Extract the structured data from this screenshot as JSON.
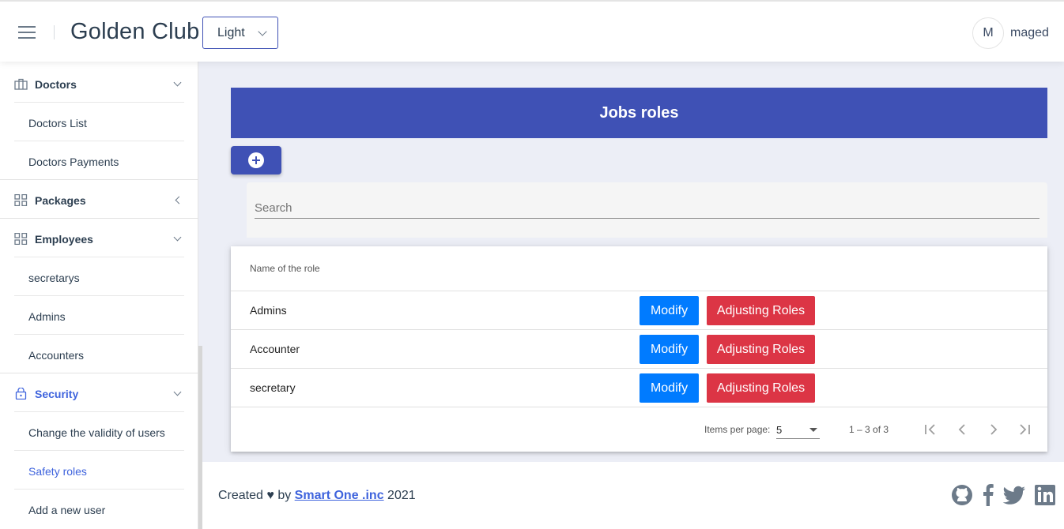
{
  "header": {
    "title": "Golden Club",
    "theme_value": "Light",
    "avatar_initial": "M",
    "username": "maged"
  },
  "sidebar": {
    "items": [
      {
        "label": "Doctors",
        "type": "group",
        "icon": "briefcase-icon",
        "chevron": "down"
      },
      {
        "label": "Doctors List",
        "type": "sub"
      },
      {
        "label": "Doctors Payments",
        "type": "sub"
      },
      {
        "label": "Packages",
        "type": "group",
        "icon": "grid-icon",
        "chevron": "left"
      },
      {
        "label": "Employees",
        "type": "group",
        "icon": "grid-icon",
        "chevron": "down"
      },
      {
        "label": "secretarys",
        "type": "sub"
      },
      {
        "label": "Admins",
        "type": "sub"
      },
      {
        "label": "Accounters",
        "type": "sub"
      },
      {
        "label": "Security",
        "type": "group",
        "icon": "lock-icon",
        "chevron": "down",
        "active": true
      },
      {
        "label": "Change the validity of users",
        "type": "sub"
      },
      {
        "label": "Safety roles",
        "type": "sub",
        "active": true
      },
      {
        "label": "Add a new user",
        "type": "sub"
      }
    ]
  },
  "main": {
    "banner_title": "Jobs roles",
    "add_icon": "plus-circle-icon",
    "search_placeholder": "Search",
    "table": {
      "columns": [
        "Name of the role"
      ],
      "rows": [
        {
          "name": "Admins",
          "modify_label": "Modify",
          "adjust_label": "Adjusting Roles"
        },
        {
          "name": "Accounter",
          "modify_label": "Modify",
          "adjust_label": "Adjusting Roles"
        },
        {
          "name": "secretary",
          "modify_label": "Modify",
          "adjust_label": "Adjusting Roles"
        }
      ]
    },
    "paginator": {
      "items_per_page_label": "Items per page:",
      "page_size": "5",
      "range_label": "1 – 3 of 3"
    }
  },
  "footer": {
    "created": "Created ♥ by",
    "company": "Smart One .inc",
    "year": "2021",
    "social_icons": [
      "github-icon",
      "facebook-icon",
      "twitter-icon",
      "linkedin-icon"
    ]
  },
  "colors": {
    "primary": "#3f51b5",
    "modify": "#007bff",
    "adjust": "#dc3545",
    "link": "#3e63dd",
    "background": "#eceef6"
  }
}
